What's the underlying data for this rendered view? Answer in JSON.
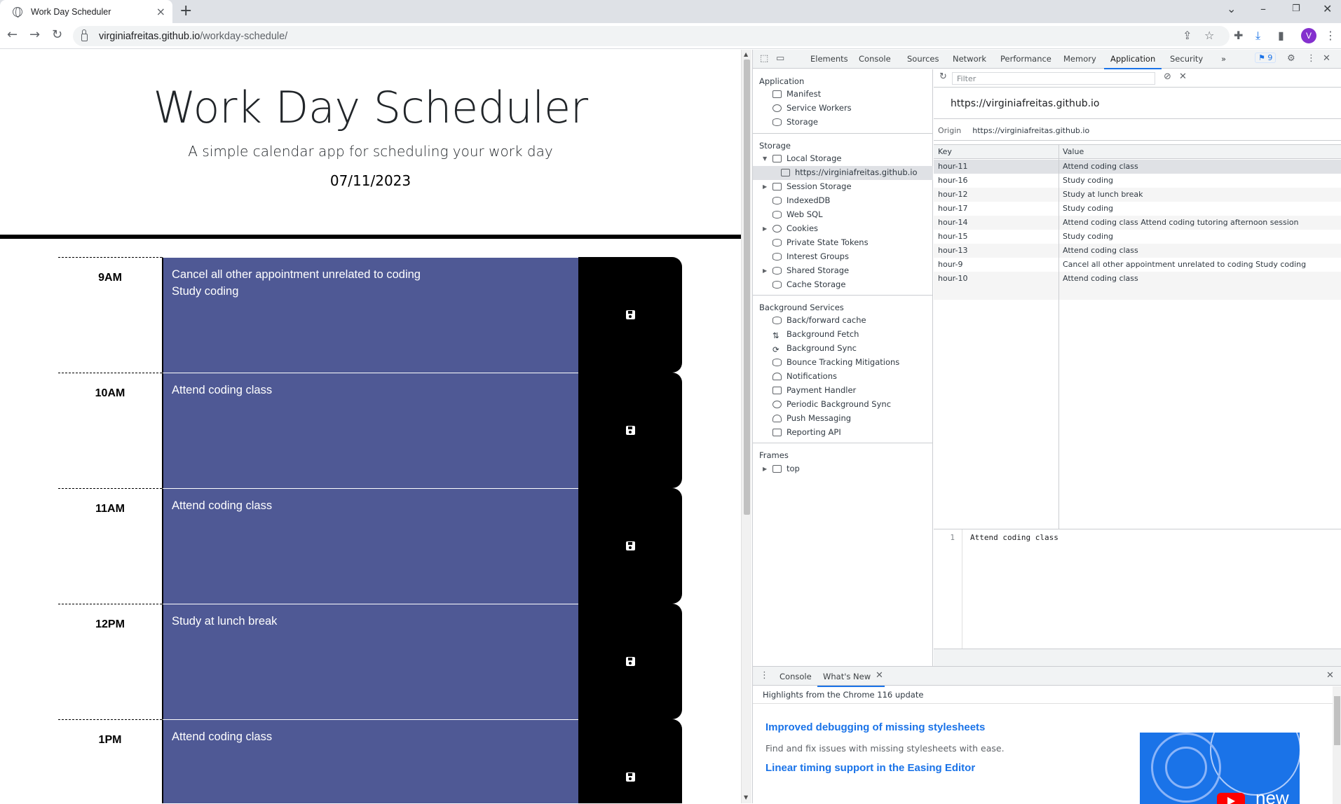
{
  "browser": {
    "tab_title": "Work Day Scheduler",
    "url_host": "virginiafreitas.github.io",
    "url_path": "/workday-schedule/",
    "profile_initial": "V"
  },
  "page": {
    "title": "Work Day Scheduler",
    "lead": "A simple calendar app for scheduling your work day",
    "date": "07/11/2023",
    "rows": [
      {
        "hour": "9AM",
        "text": "Cancel all other appointment unrelated to coding\nStudy coding"
      },
      {
        "hour": "10AM",
        "text": "Attend coding class"
      },
      {
        "hour": "11AM",
        "text": " Attend coding class"
      },
      {
        "hour": "12PM",
        "text": "Study at lunch break"
      },
      {
        "hour": "1PM",
        "text": " Attend coding class"
      }
    ],
    "row_color": "#4f5995"
  },
  "devtools": {
    "tabs": [
      "Elements",
      "Console",
      "Sources",
      "Network",
      "Performance",
      "Memory",
      "Application",
      "Security"
    ],
    "active_tab": "Application",
    "issues_count": "9",
    "sidebar": {
      "application_title": "Application",
      "application_items": [
        "Manifest",
        "Service Workers",
        "Storage"
      ],
      "storage_title": "Storage",
      "storage_items": [
        "Local Storage",
        "https://virginiafreitas.github.io",
        "Session Storage",
        "IndexedDB",
        "Web SQL",
        "Cookies",
        "Private State Tokens",
        "Interest Groups",
        "Shared Storage",
        "Cache Storage"
      ],
      "background_title": "Background Services",
      "background_items": [
        "Back/forward cache",
        "Background Fetch",
        "Background Sync",
        "Bounce Tracking Mitigations",
        "Notifications",
        "Payment Handler",
        "Periodic Background Sync",
        "Push Messaging",
        "Reporting API"
      ],
      "frames_title": "Frames",
      "frames_items": [
        "top"
      ]
    },
    "filter_placeholder": "Filter",
    "origin_heading": "https://virginiafreitas.github.io",
    "origin_label": "Origin",
    "origin_value": "https://virginiafreitas.github.io",
    "table": {
      "headers": [
        "Key",
        "Value"
      ],
      "rows": [
        {
          "key": "hour-11",
          "value": "Attend coding class"
        },
        {
          "key": "hour-16",
          "value": "Study coding"
        },
        {
          "key": "hour-12",
          "value": "Study at lunch break"
        },
        {
          "key": "hour-17",
          "value": "Study coding"
        },
        {
          "key": "hour-14",
          "value": "Attend coding class Attend coding tutoring afternoon session"
        },
        {
          "key": "hour-15",
          "value": "Study coding"
        },
        {
          "key": "hour-13",
          "value": "Attend coding class"
        },
        {
          "key": "hour-9",
          "value": "Cancel all other appointment unrelated to coding Study coding"
        },
        {
          "key": "hour-10",
          "value": "Attend coding class"
        }
      ]
    },
    "preview": {
      "line": "1",
      "code": "Attend coding class"
    },
    "drawer": {
      "tabs": [
        "Console",
        "What's New"
      ],
      "highlights": "Highlights from the Chrome 116 update",
      "link1": "Improved debugging of missing stylesheets",
      "text1": "Find and fix issues with missing stylesheets with ease.",
      "link2": "Linear timing support in the Easing Editor",
      "image_text": "new"
    }
  }
}
